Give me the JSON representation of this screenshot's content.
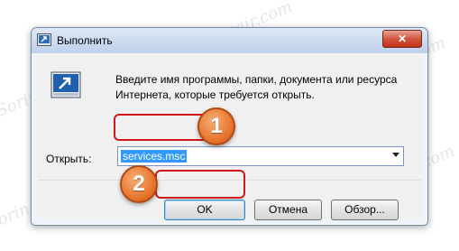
{
  "window": {
    "title": "Выполнить",
    "close_label": "✕"
  },
  "description": "Введите имя программы, папки, документа или ресурса Интернета, которые требуется открыть.",
  "open_field": {
    "label": "Открыть:",
    "value": "services.msc"
  },
  "buttons": {
    "ok": "OK",
    "cancel": "Отмена",
    "browse": "Обзор..."
  },
  "annotations": {
    "step1": "1",
    "step2": "2"
  },
  "watermark": "Soringpcrepair.com",
  "colors": {
    "highlight": "#d01818",
    "badge": "#e8772f",
    "selection": "#3399ff"
  }
}
